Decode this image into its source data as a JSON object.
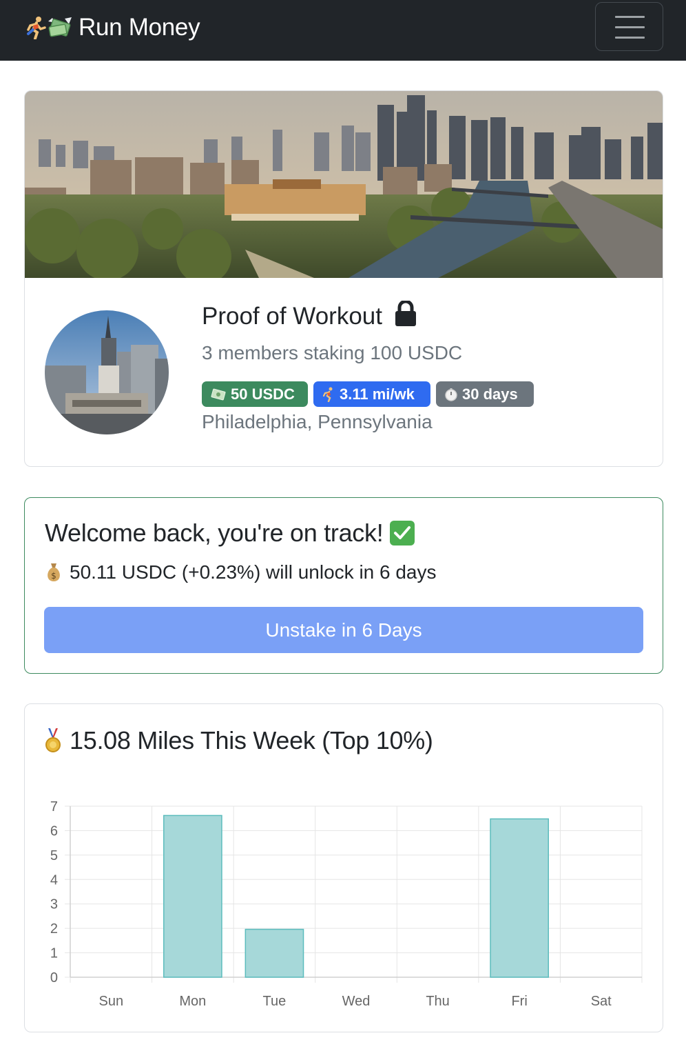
{
  "navbar": {
    "brand_text": "Run Money",
    "menu_label": "menu"
  },
  "club": {
    "title": "Proof of Workout",
    "subtitle": "3 members staking 100 USDC",
    "badges": [
      {
        "icon": "money-icon",
        "text": "50 USDC",
        "color": "#3c8a5e"
      },
      {
        "icon": "runner-icon",
        "text": "3.11 mi/wk",
        "color": "#2f6bf0"
      },
      {
        "icon": "stopwatch-icon",
        "text": "30 days",
        "color": "#6c757d"
      }
    ],
    "location": "Philadelphia, Pennsylvania"
  },
  "status": {
    "title": "Welcome back, you're on track!",
    "unlock_text": "50.11 USDC (+0.23%) will unlock in 6 days",
    "button_label": "Unstake in 6 Days"
  },
  "weekly": {
    "title": "15.08 Miles This Week (Top 10%)"
  },
  "colors": {
    "navbar": "#212529",
    "accent_green": "#3c8a5e",
    "accent_blue": "#2f6bf0",
    "button": "#7aa0f6",
    "bar_fill": "#a6d8d9",
    "bar_stroke": "#5cbcbd"
  },
  "chart_data": {
    "type": "bar",
    "categories": [
      "Sun",
      "Mon",
      "Tue",
      "Wed",
      "Thu",
      "Fri",
      "Sat"
    ],
    "values": [
      0,
      6.62,
      1.96,
      0,
      0,
      6.48,
      0
    ],
    "ylim": [
      0,
      7
    ],
    "yticks": [
      "0",
      "1",
      "2",
      "3",
      "4",
      "5",
      "6",
      "7"
    ],
    "grid": true
  }
}
